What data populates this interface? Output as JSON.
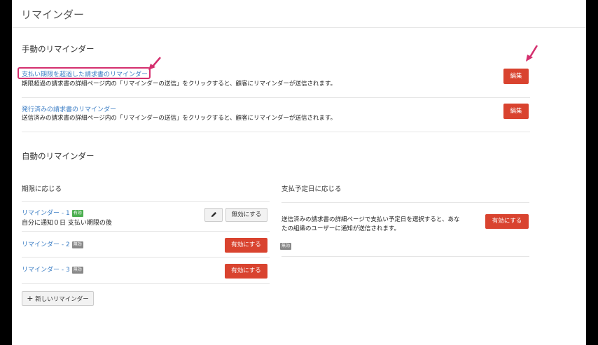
{
  "page": {
    "title": "リマインダー"
  },
  "manual": {
    "heading": "手動のリマインダー",
    "items": [
      {
        "link": "支払い期限を超過した請求書のリマインダー",
        "desc": "期限超過の請求書の詳細ページ内の「リマインダーの送信」をクリックすると、顧客にリマインダーが送信されます。",
        "button": "編集"
      },
      {
        "link": "発行済みの請求書のリマインダー",
        "desc": "送信済みの請求書の詳細ページ内の「リマインダーの送信」をクリックすると、顧客にリマインダーが送信されます。",
        "button": "編集"
      }
    ]
  },
  "auto": {
    "heading": "自動のリマインダー",
    "due": {
      "heading": "期限に応じる",
      "reminders": [
        {
          "name": "リマインダー - 1",
          "badge": "有効",
          "desc": "自分に通知０日 支払い期限の後",
          "button": "無効にする"
        },
        {
          "name": "リマインダー - 2",
          "badge": "無効",
          "button": "有効にする"
        },
        {
          "name": "リマインダー - 3",
          "badge": "無効",
          "button": "有効にする"
        }
      ],
      "new_button": "新しいリマインダー"
    },
    "expected": {
      "heading": "支払予定日に応じる",
      "desc_line1": "送信済みの請求書の詳細ページで支払い予定日を選択すると、あな",
      "desc_line2": "たの組織のユーザーに通知が送信されます。",
      "badge": "無効",
      "button": "有効にする"
    }
  },
  "colors": {
    "accent": "#d9432f",
    "link": "#3b7dc4",
    "annotation": "#d42f6e",
    "badge_on": "#4caf50",
    "badge_off": "#888888"
  },
  "icons": [
    "pencil-icon",
    "plus-icon",
    "arrow-annotation-icon"
  ]
}
